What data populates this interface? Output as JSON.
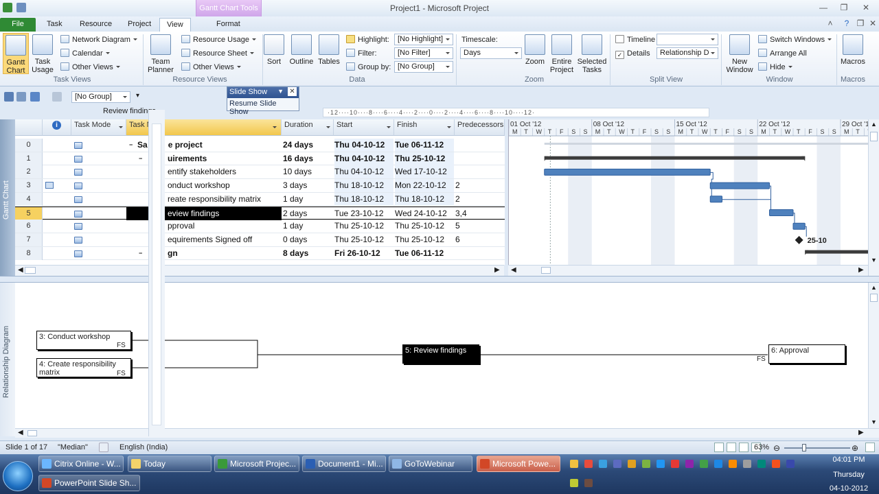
{
  "window": {
    "title": "Project1  -  Microsoft Project",
    "context_tools": "Gantt Chart Tools"
  },
  "tabs": [
    "File",
    "Task",
    "Resource",
    "Project",
    "View",
    "Format"
  ],
  "ribbon": {
    "gantt_chart": "Gantt\nChart",
    "task_usage": "Task\nUsage",
    "network_diagram": "Network Diagram",
    "calendar": "Calendar",
    "other_views": "Other Views",
    "task_views": "Task Views",
    "team_planner": "Team\nPlanner",
    "resource_usage": "Resource Usage",
    "resource_sheet": "Resource Sheet",
    "other_views2": "Other Views",
    "resource_views": "Resource Views",
    "sort": "Sort",
    "outline": "Outline",
    "tables": "Tables",
    "highlight_label": "Highlight:",
    "highlight_value": "[No Highlight]",
    "filter_label": "Filter:",
    "filter_value": "[No Filter]",
    "group_label": "Group by:",
    "group_value": "[No Group]",
    "data": "Data",
    "timescale_label": "Timescale:",
    "timescale_value": "Days",
    "zoom": "Zoom",
    "entire_project": "Entire\nProject",
    "selected_tasks": "Selected\nTasks",
    "zoom_group": "Zoom",
    "timeline": "Timeline",
    "details": "Details",
    "details_value": "Relationship D",
    "split_view": "Split View",
    "new_window": "New\nWindow",
    "switch_windows": "Switch Windows",
    "arrange_all": "Arrange All",
    "hide": "Hide",
    "window_group": "Window",
    "macros": "Macros",
    "macros_group": "Macros"
  },
  "qat": {
    "group_combo": "[No Group]"
  },
  "slideshow_popup": {
    "title": "Slide Show",
    "item": "Resume Slide Show"
  },
  "entry_bar": {
    "value": "Review findings"
  },
  "ruler_h": "·12····10····8····6····4····2····0····2····4····6····8····10····12·",
  "side_labels": {
    "top": "Gantt Chart",
    "bottom": "Relationship Diagram"
  },
  "grid": {
    "headers": {
      "task_mode": "Task Mode",
      "task_name": "Task N",
      "duration": "Duration",
      "start": "Start",
      "finish": "Finish",
      "predecessors": "Predecessors"
    },
    "rows": [
      {
        "id": "0",
        "name": "Sa",
        "name2": "e project",
        "duration": "24 days",
        "start": "Thu 04-10-12",
        "finish": "Tue 06-11-12",
        "pred": "",
        "bold": true
      },
      {
        "id": "1",
        "name": "",
        "name2": "uirements",
        "duration": "16 days",
        "start": "Thu 04-10-12",
        "finish": "Thu 25-10-12",
        "pred": "",
        "bold": true
      },
      {
        "id": "2",
        "name": "",
        "name2": "entify stakeholders",
        "duration": "10 days",
        "start": "Thu 04-10-12",
        "finish": "Wed 17-10-12",
        "pred": "",
        "bold": false
      },
      {
        "id": "3",
        "name": "",
        "name2": "onduct workshop",
        "duration": "3 days",
        "start": "Thu 18-10-12",
        "finish": "Mon 22-10-12",
        "pred": "2",
        "bold": false
      },
      {
        "id": "4",
        "name": "",
        "name2": "reate responsibility matrix",
        "duration": "1 day",
        "start": "Thu 18-10-12",
        "finish": "Thu 18-10-12",
        "pred": "2",
        "bold": false
      },
      {
        "id": "5",
        "name": "",
        "name2": "eview findings",
        "duration": "2 days",
        "start": "Tue 23-10-12",
        "finish": "Wed 24-10-12",
        "pred": "3,4",
        "bold": false
      },
      {
        "id": "6",
        "name": "",
        "name2": "pproval",
        "duration": "1 day",
        "start": "Thu 25-10-12",
        "finish": "Thu 25-10-12",
        "pred": "5",
        "bold": false
      },
      {
        "id": "7",
        "name": "",
        "name2": "equirements Signed off",
        "duration": "0 days",
        "start": "Thu 25-10-12",
        "finish": "Thu 25-10-12",
        "pred": "6",
        "bold": false
      },
      {
        "id": "8",
        "name": "",
        "name2": "gn",
        "duration": "8 days",
        "start": "Fri 26-10-12",
        "finish": "Tue 06-11-12",
        "pred": "",
        "bold": true
      }
    ]
  },
  "gantt": {
    "weeks": [
      "01 Oct '12",
      "08 Oct '12",
      "15 Oct '12",
      "22 Oct '12",
      "29 Oct '12"
    ],
    "days": [
      "M",
      "T",
      "W",
      "T",
      "F",
      "S",
      "S",
      "M",
      "T",
      "W",
      "T",
      "F",
      "S",
      "S",
      "M",
      "T",
      "W",
      "T",
      "F",
      "S",
      "S",
      "M",
      "T",
      "W",
      "T",
      "F",
      "S",
      "S",
      "M",
      "T",
      "W"
    ],
    "milestone_label": "25-10"
  },
  "relationship": {
    "boxes": [
      "3: Conduct workshop",
      "4: Create responsibility matrix",
      "5: Review findings",
      "6: Approval"
    ],
    "fs": "FS"
  },
  "status": {
    "slide": "Slide 1 of 17",
    "theme": "\"Median\"",
    "language": "English (India)",
    "zoom": "63%"
  },
  "taskbar": {
    "buttons": [
      "Citrix Online - W...",
      "Today",
      "Microsoft Projec...",
      "Document1 - Mi...",
      "GoToWebinar",
      "Microsoft Powe...",
      "PowerPoint Slide Sh..."
    ],
    "time": "04:01 PM",
    "day": "Thursday",
    "date": "04-10-2012"
  },
  "colors": {
    "accent": "#2f8a34",
    "bar": "#4f81bd",
    "selection": "#000000"
  }
}
